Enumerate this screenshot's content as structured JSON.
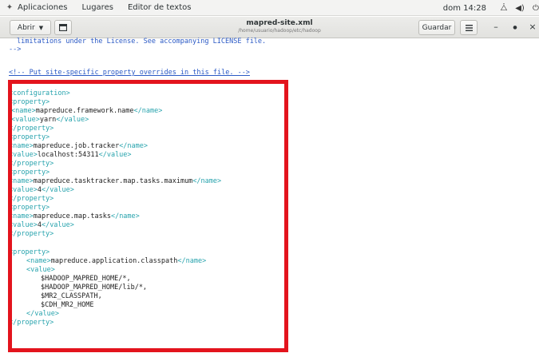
{
  "topbar": {
    "applications": "Aplicaciones",
    "places": "Lugares",
    "app_name": "Editor de textos",
    "clock": "dom 14:28"
  },
  "headerbar": {
    "open_label": "Abrir",
    "title": "mapred-site.xml",
    "subtitle": "/home/usuario/hadoop/etc/hadoop",
    "save_label": "Guardar"
  },
  "editor": {
    "lines": [
      "limitations under the License. See accompanying LICENSE file.",
      "-->",
      "",
      "<!-- Put site-specific property overrides in this file. -->",
      "",
      "<configuration>",
      "<property>",
      "<name>mapreduce.framework.name</name>",
      "<value>yarn</value>",
      "</property>",
      "<property>",
      "<name>mapreduce.job.tracker</name>",
      "<value>localhost:54311</value>",
      "</property>",
      "<property>",
      "<name>mapreduce.tasktracker.map.tasks.maximum</name>",
      "<value>4</value>",
      "</property>",
      "<property>",
      "<name>mapreduce.map.tasks</name>",
      "<value>4</value>",
      "</property>",
      "",
      "<property>",
      "<name>mapreduce.application.classpath</name>",
      "<value>",
      "$HADOOP_MAPRED_HOME/*,",
      "$HADOOP_MAPRED_HOME/lib/*,",
      "$MR2_CLASSPATH,",
      "$CDH_MR2_HOME",
      "</value>",
      "</property>"
    ]
  },
  "colors": {
    "comment": "#2a59c5",
    "tag": "#27a3ad",
    "text": "#1e1e1e",
    "highlight_border": "#e3141d"
  }
}
